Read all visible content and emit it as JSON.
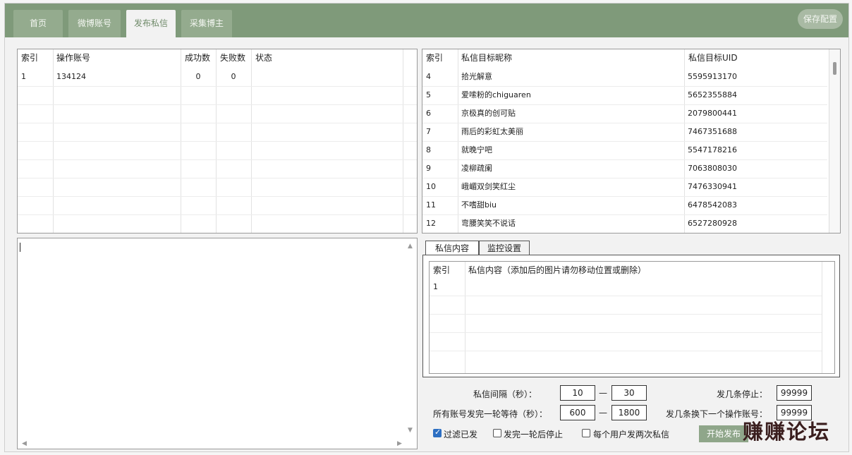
{
  "tabs": [
    "首页",
    "微博账号",
    "发布私信",
    "采集博主"
  ],
  "save_label": "保存配置",
  "accounts": {
    "headers": [
      "索引",
      "操作账号",
      "成功数",
      "失败数",
      "状态"
    ],
    "rows": [
      {
        "idx": "1",
        "account": "134124",
        "success": "0",
        "fail": "0",
        "status": ""
      }
    ]
  },
  "targets": {
    "headers": [
      "索引",
      "私信目标昵称",
      "私信目标UID"
    ],
    "rows": [
      {
        "idx": "4",
        "nick": "拾光解意",
        "uid": "5595913170"
      },
      {
        "idx": "5",
        "nick": "爱嗦粉的chiguaren",
        "uid": "5652355884"
      },
      {
        "idx": "6",
        "nick": "京极真的创可贴",
        "uid": "2079800441"
      },
      {
        "idx": "7",
        "nick": "雨后的彩虹太美丽",
        "uid": "7467351688"
      },
      {
        "idx": "8",
        "nick": "就晚宁吧",
        "uid": "5547178216"
      },
      {
        "idx": "9",
        "nick": "凌柳疏阑",
        "uid": "7063808030"
      },
      {
        "idx": "10",
        "nick": "峨嵋双剑笑红尘",
        "uid": "7476330941"
      },
      {
        "idx": "11",
        "nick": "不嗜甜biu",
        "uid": "6478542083"
      },
      {
        "idx": "12",
        "nick": "弯腰笑笑不说话",
        "uid": "6527280928"
      }
    ]
  },
  "subtabs": [
    "私信内容",
    "监控设置"
  ],
  "messages": {
    "headers": [
      "索引",
      "私信内容（添加后的图片请勿移动位置或删除）"
    ],
    "rows": [
      {
        "idx": "1",
        "content": ""
      }
    ]
  },
  "settings": {
    "interval_label": "私信间隔（秒）：",
    "interval_min": "10",
    "interval_max": "30",
    "round_wait_label": "所有账号发完一轮等待（秒）：",
    "round_wait_min": "600",
    "round_wait_max": "1800",
    "dash": "—",
    "stop_after_label": "发几条停止：",
    "stop_after_value": "99999",
    "switch_after_label": "发几条换下一个操作账号：",
    "switch_after_value": "99999",
    "cb_filter_label": "过滤已发",
    "cb_stop_round_label": "发完一轮后停止",
    "cb_twice_label": "每个用户发两次私信",
    "start_label": "开始发布"
  },
  "watermark": "赚赚论坛"
}
